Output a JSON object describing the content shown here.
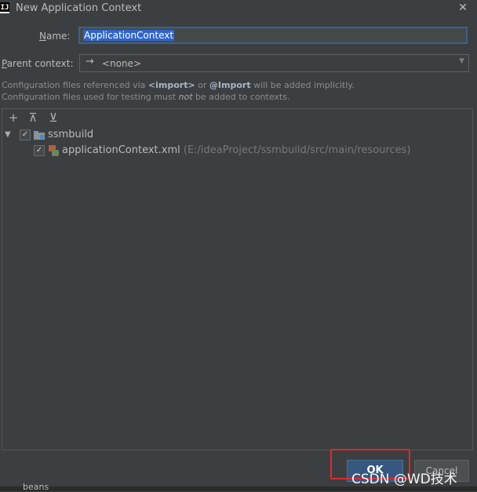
{
  "window": {
    "app_icon": "IJ",
    "title": "New Application Context",
    "close_glyph": "✕"
  },
  "form": {
    "name_label_mn": "N",
    "name_label_rest": "ame:",
    "name_value": "ApplicationContext",
    "parent_label_mn": "P",
    "parent_label_rest": "arent context:",
    "parent_arrow": "→",
    "parent_value": "<none>",
    "parent_chevron": "▼"
  },
  "info": {
    "line1_a": "Configuration files referenced via ",
    "line1_b": "<import>",
    "line1_c": " or ",
    "line1_d": "@Import",
    "line1_e": " will be added implicitly.",
    "line2_a": "Configuration files used for testing must ",
    "line2_b": "not",
    "line2_c": " be added to contexts."
  },
  "toolbar": {
    "add_glyph": "+",
    "expand_glyph": "⊼",
    "collapse_glyph": "⊻"
  },
  "tree": {
    "root": {
      "expander": "▼",
      "checked": "✓",
      "label": "ssmbuild"
    },
    "child": {
      "checked": "✓",
      "label": "applicationContext.xml",
      "path": " (E:/ideaProject/ssmbuild/src/main/resources)"
    }
  },
  "buttons": {
    "ok": "OK",
    "cancel": "Cancel"
  },
  "overlay": {
    "watermark": "CSDN @WD技术",
    "background_text": "beans",
    "highlight_color": "#e0282e"
  }
}
